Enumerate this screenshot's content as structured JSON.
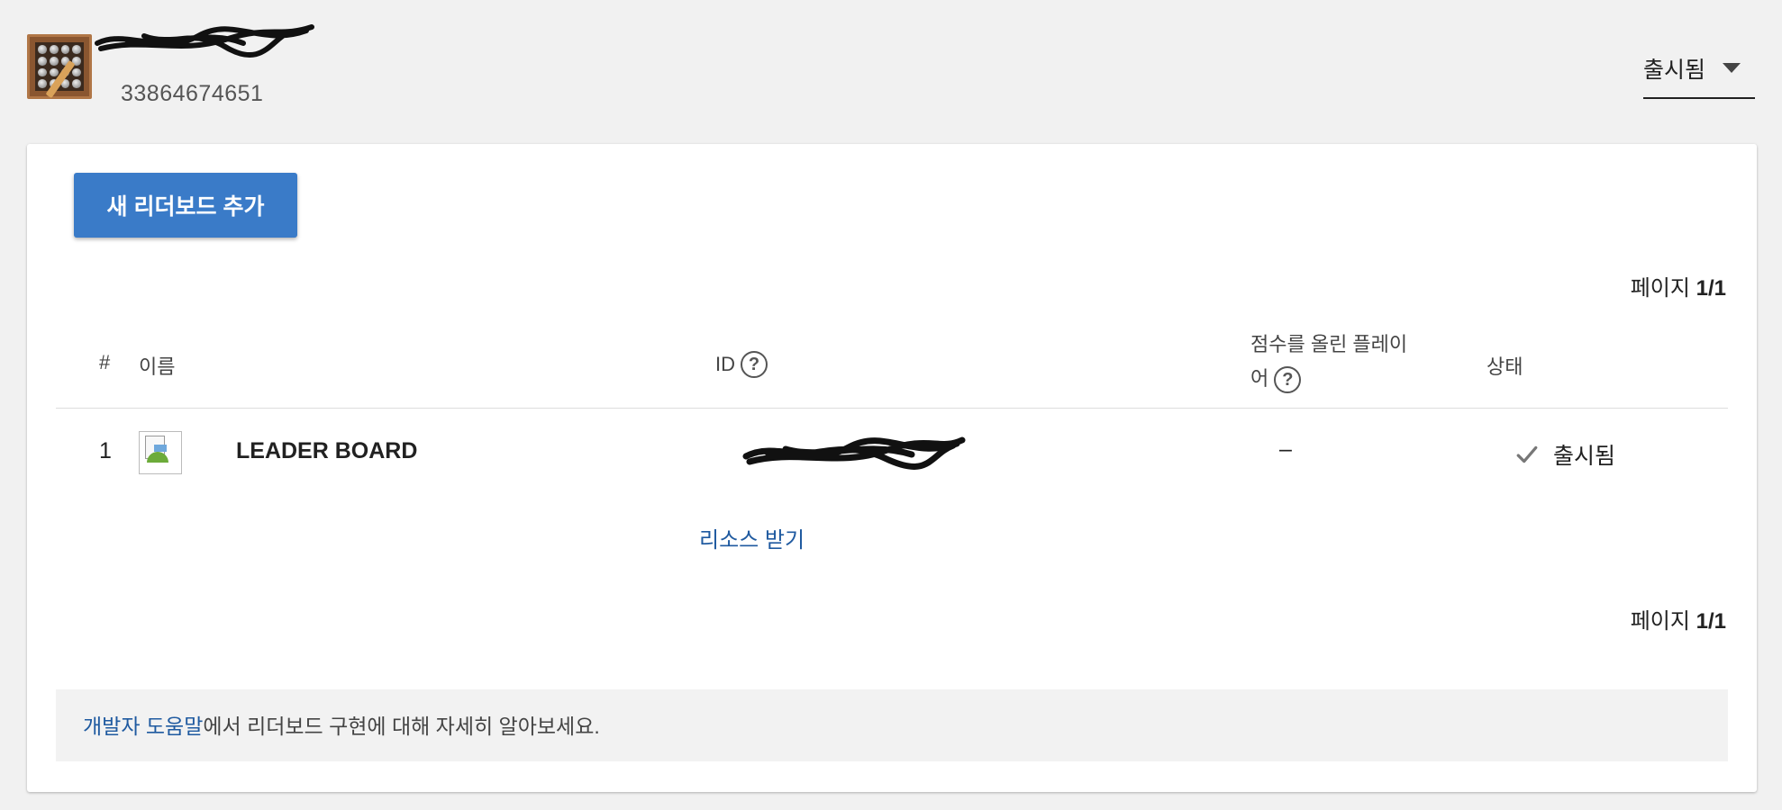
{
  "header": {
    "app_id": "33864674651",
    "status_select": {
      "selected": "출시됨"
    }
  },
  "toolbar": {
    "add_button_label": "새 리더보드 추가"
  },
  "pagination": {
    "prefix": "페이지",
    "current": "1/1"
  },
  "table": {
    "columns": {
      "number": "#",
      "name": "이름",
      "id": "ID",
      "players_scored": "점수를 올린 플레이어",
      "status": "상태"
    },
    "rows": [
      {
        "number": "1",
        "name": "LEADER BOARD",
        "players_scored": "–",
        "status": "출시됨"
      }
    ]
  },
  "get_resources_link": "리소스 받기",
  "help_footer": {
    "link_text": "개발자 도움말",
    "rest_text": "에서 리더보드 구현에 대해 자세히 알아보세요."
  },
  "colors": {
    "primary_button": "#3a7bc8",
    "link": "#1f5aa0",
    "background": "#f1f1f1"
  }
}
